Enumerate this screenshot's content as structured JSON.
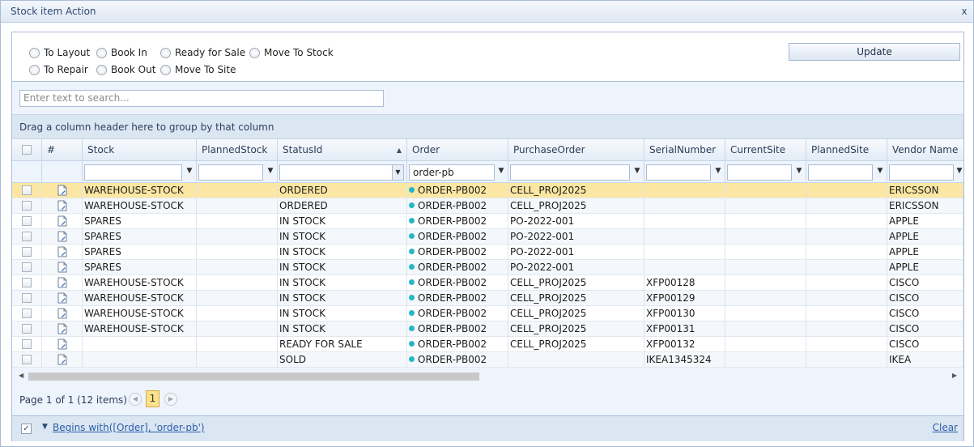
{
  "window": {
    "title": "Stock item Action",
    "close_label": "x"
  },
  "actions": {
    "options": [
      {
        "label": "To Layout"
      },
      {
        "label": "Book In"
      },
      {
        "label": "Ready for Sale"
      },
      {
        "label": "Move To Stock"
      },
      {
        "label": "To Repair"
      },
      {
        "label": "Book Out"
      },
      {
        "label": "Move To Site"
      }
    ],
    "update_label": "Update"
  },
  "grid": {
    "search_placeholder": "Enter text to search...",
    "group_panel_text": "Drag a column header here to group by that column",
    "columns": [
      {
        "label": ""
      },
      {
        "label": "#"
      },
      {
        "label": "Stock"
      },
      {
        "label": "PlannedStock"
      },
      {
        "label": "StatusId"
      },
      {
        "label": "Order"
      },
      {
        "label": "PurchaseOrder"
      },
      {
        "label": "SerialNumber"
      },
      {
        "label": "CurrentSite"
      },
      {
        "label": "PlannedSite"
      },
      {
        "label": "Vendor Name"
      }
    ],
    "sorted_column": "StatusId",
    "order_filter_value": "order-pb",
    "rows": [
      {
        "stock": "WAREHOUSE-STOCK",
        "planned_stock": "",
        "status": "ORDERED",
        "order": "ORDER-PB002",
        "purchase_order": "CELL_PROJ2025",
        "serial": "",
        "current_site": "",
        "planned_site": "",
        "vendor": "ERICSSON"
      },
      {
        "stock": "WAREHOUSE-STOCK",
        "planned_stock": "",
        "status": "ORDERED",
        "order": "ORDER-PB002",
        "purchase_order": "CELL_PROJ2025",
        "serial": "",
        "current_site": "",
        "planned_site": "",
        "vendor": "ERICSSON"
      },
      {
        "stock": "SPARES",
        "planned_stock": "",
        "status": "IN STOCK",
        "order": "ORDER-PB002",
        "purchase_order": "PO-2022-001",
        "serial": "",
        "current_site": "",
        "planned_site": "",
        "vendor": "APPLE"
      },
      {
        "stock": "SPARES",
        "planned_stock": "",
        "status": "IN STOCK",
        "order": "ORDER-PB002",
        "purchase_order": "PO-2022-001",
        "serial": "",
        "current_site": "",
        "planned_site": "",
        "vendor": "APPLE"
      },
      {
        "stock": "SPARES",
        "planned_stock": "",
        "status": "IN STOCK",
        "order": "ORDER-PB002",
        "purchase_order": "PO-2022-001",
        "serial": "",
        "current_site": "",
        "planned_site": "",
        "vendor": "APPLE"
      },
      {
        "stock": "SPARES",
        "planned_stock": "",
        "status": "IN STOCK",
        "order": "ORDER-PB002",
        "purchase_order": "PO-2022-001",
        "serial": "",
        "current_site": "",
        "planned_site": "",
        "vendor": "APPLE"
      },
      {
        "stock": "WAREHOUSE-STOCK",
        "planned_stock": "",
        "status": "IN STOCK",
        "order": "ORDER-PB002",
        "purchase_order": "CELL_PROJ2025",
        "serial": "XFP00128",
        "current_site": "",
        "planned_site": "",
        "vendor": "CISCO"
      },
      {
        "stock": "WAREHOUSE-STOCK",
        "planned_stock": "",
        "status": "IN STOCK",
        "order": "ORDER-PB002",
        "purchase_order": "CELL_PROJ2025",
        "serial": "XFP00129",
        "current_site": "",
        "planned_site": "",
        "vendor": "CISCO"
      },
      {
        "stock": "WAREHOUSE-STOCK",
        "planned_stock": "",
        "status": "IN STOCK",
        "order": "ORDER-PB002",
        "purchase_order": "CELL_PROJ2025",
        "serial": "XFP00130",
        "current_site": "",
        "planned_site": "",
        "vendor": "CISCO"
      },
      {
        "stock": "WAREHOUSE-STOCK",
        "planned_stock": "",
        "status": "IN STOCK",
        "order": "ORDER-PB002",
        "purchase_order": "CELL_PROJ2025",
        "serial": "XFP00131",
        "current_site": "",
        "planned_site": "",
        "vendor": "CISCO"
      },
      {
        "stock": "",
        "planned_stock": "",
        "status": "READY FOR SALE",
        "order": "ORDER-PB002",
        "purchase_order": "CELL_PROJ2025",
        "serial": "XFP00132",
        "current_site": "",
        "planned_site": "",
        "vendor": "CISCO"
      },
      {
        "stock": "",
        "planned_stock": "",
        "status": "SOLD",
        "order": "ORDER-PB002",
        "purchase_order": "",
        "serial": "IKEA1345324",
        "current_site": "",
        "planned_site": "",
        "vendor": "IKEA"
      }
    ],
    "selected_row_index": 0,
    "status_dot_color": "#26b7c7"
  },
  "pager": {
    "info": "Page 1 of 1 (12 items)",
    "current_page": "1"
  },
  "filter_bar": {
    "expression": "Begins with([Order], 'order-pb')",
    "clear_label": "Clear",
    "enabled_mark": "✓"
  }
}
